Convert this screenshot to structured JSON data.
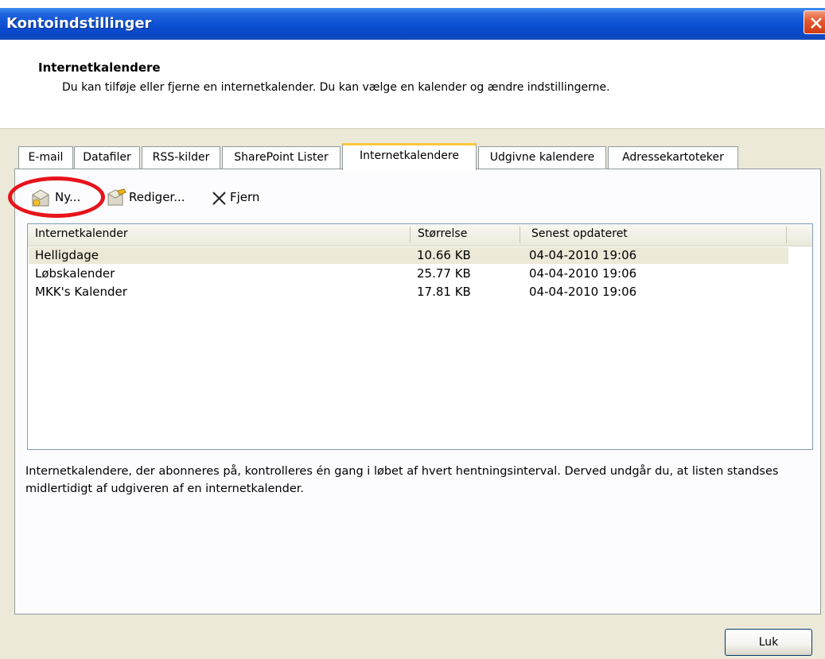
{
  "window": {
    "title": "Kontoindstillinger"
  },
  "header": {
    "title": "Internetkalendere",
    "description": "Du kan tilføje eller fjerne en internetkalender. Du kan vælge en kalender og ændre indstillingerne."
  },
  "tabs": [
    {
      "label": "E-mail"
    },
    {
      "label": "Datafiler"
    },
    {
      "label": "RSS-kilder"
    },
    {
      "label": "SharePoint Lister"
    },
    {
      "label": "Internetkalendere",
      "active": true
    },
    {
      "label": "Udgivne kalendere"
    },
    {
      "label": "Adressekartoteker"
    }
  ],
  "toolbar": {
    "new_label": "Ny...",
    "edit_label": "Rediger...",
    "remove_label": "Fjern"
  },
  "table": {
    "columns": [
      "Internetkalender",
      "Størrelse",
      "Senest opdateret"
    ],
    "rows": [
      {
        "name": "Helligdage",
        "size": "10.66 KB",
        "updated": "04-04-2010 19:06",
        "selected": true
      },
      {
        "name": "Løbskalender",
        "size": "25.77 KB",
        "updated": "04-04-2010 19:06"
      },
      {
        "name": "MKK's Kalender",
        "size": "17.81 KB",
        "updated": "04-04-2010 19:06"
      }
    ]
  },
  "footer": {
    "info": "Internetkalendere, der abonneres på, kontrolleres én gang i løbet af hvert hentningsinterval. Derved undgår du, at listen standses midlertidigt af udgiveren af en internetkalender."
  },
  "buttons": {
    "close_label": "Luk"
  },
  "colors": {
    "titlebar": "#0b4fd3",
    "active_tab_accent": "#ffc73c",
    "highlight_circle": "#e8131b",
    "dialog_bg": "#ece9d8"
  }
}
